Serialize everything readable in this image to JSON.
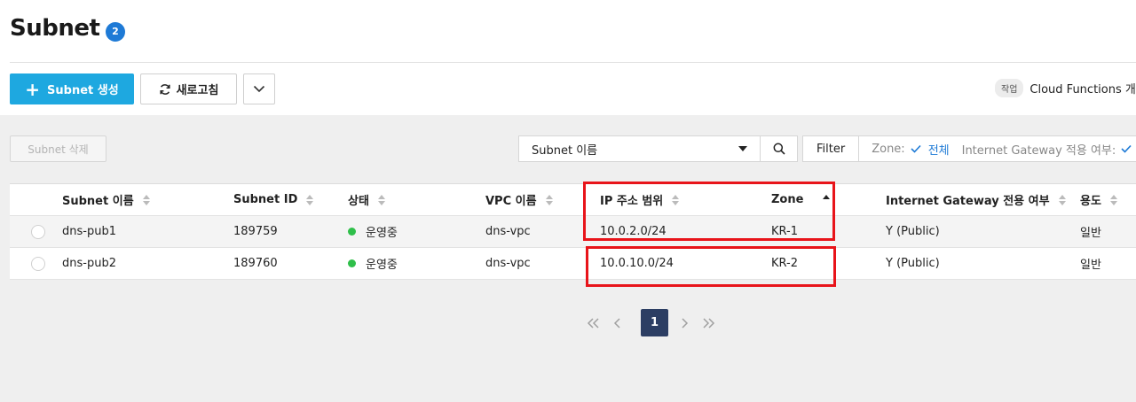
{
  "page": {
    "title": "Subnet",
    "count": "2"
  },
  "toolbar": {
    "create_label": "Subnet 생성",
    "refresh_label": "새로고침"
  },
  "task": {
    "tag": "작업",
    "text": "Cloud Functions 개설"
  },
  "actions": {
    "delete_label": "Subnet 삭제"
  },
  "search": {
    "selected_field": "Subnet 이름"
  },
  "filter": {
    "label": "Filter",
    "items": [
      {
        "key": "Zone:",
        "value": "전체"
      },
      {
        "key": "Internet Gateway 적용 여부:",
        "value": ""
      }
    ]
  },
  "table": {
    "columns": [
      "Subnet 이름",
      "Subnet ID",
      "상태",
      "VPC 이름",
      "IP 주소 범위",
      "Zone",
      "Internet Gateway 전용 여부",
      "용도"
    ],
    "sorted_column": "Zone",
    "rows": [
      {
        "name": "dns-pub1",
        "id": "189759",
        "status": "운영중",
        "vpc": "dns-vpc",
        "ip_range": "10.0.2.0/24",
        "zone": "KR-1",
        "igw": "Y (Public)",
        "usage": "일반"
      },
      {
        "name": "dns-pub2",
        "id": "189760",
        "status": "운영중",
        "vpc": "dns-vpc",
        "ip_range": "10.0.10.0/24",
        "zone": "KR-2",
        "igw": "Y (Public)",
        "usage": "일반"
      }
    ]
  },
  "pagination": {
    "current_page": "1"
  },
  "colors": {
    "primary": "#1ea8e0",
    "badge": "#1e7ad6",
    "status_running": "#2fbf4a",
    "highlight": "#e8141a",
    "pager_active": "#2c3e63"
  },
  "icons": [
    "plus-icon",
    "refresh-icon",
    "chevron-down-icon",
    "caret-down-icon",
    "search-icon",
    "check-icon",
    "sort-icon",
    "first-page-icon",
    "prev-page-icon",
    "next-page-icon",
    "last-page-icon"
  ]
}
